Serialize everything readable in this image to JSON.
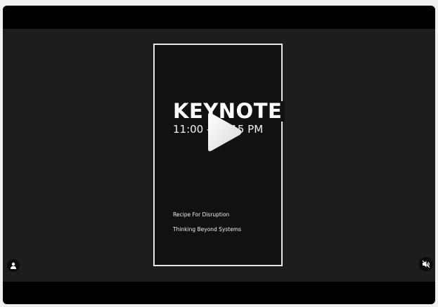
{
  "poster": {
    "title": "KEYNOTE",
    "time": "11:00 - 12:15 PM",
    "line1": "Recipe For Disruption",
    "line2": "Thinking Beyond Systems"
  },
  "controls": {
    "play_icon": "play-icon",
    "user_icon": "user-icon",
    "mute_icon": "muted-speaker-icon"
  },
  "colors": {
    "player_background": "#000000",
    "video_background": "#1d1d1d",
    "poster_border": "#e6e6e6",
    "text": "#ffffff"
  }
}
